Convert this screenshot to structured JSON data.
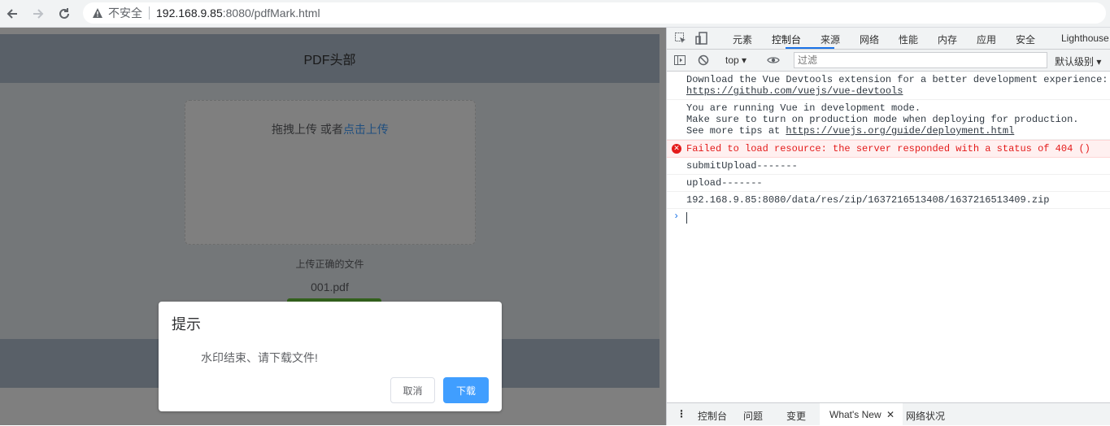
{
  "browser": {
    "security_label": "不安全",
    "url_host": "192.168.9.85",
    "url_rest": ":8080/pdfMark.html"
  },
  "page": {
    "header_title": "PDF头部",
    "upload": {
      "drag_text": "拖拽上传 或者",
      "click_text": "点击上传",
      "tip": "上传正确的文件",
      "file_name": "001.pdf"
    },
    "dialog": {
      "title": "提示",
      "message": "水印结束、请下载文件!",
      "cancel_label": "取消",
      "confirm_label": "下载"
    }
  },
  "devtools": {
    "tabs": [
      "元素",
      "控制台",
      "来源",
      "网络",
      "性能",
      "内存",
      "应用",
      "安全",
      "Lighthouse"
    ],
    "active_tab": "控制台",
    "context": "top",
    "filter_placeholder": "过滤",
    "levels": "默认级别",
    "messages": [
      {
        "line1": "Download the Vue Devtools extension for a better development experience:",
        "link": "https://github.com/vuejs/vue-devtools"
      },
      {
        "line1": "You are running Vue in development mode.",
        "line2": "Make sure to turn on production mode when deploying for production.",
        "line3_prefix": "See more tips at ",
        "link": "https://vuejs.org/guide/deployment.html"
      },
      {
        "text": "Failed to load resource: the server responded with a status of 404 ()",
        "level": "error"
      },
      {
        "text": "submitUpload-------"
      },
      {
        "text": "upload-------"
      },
      {
        "text": "192.168.9.85:8080/data/res/zip/1637216513408/1637216513409.zip"
      }
    ],
    "drawer_tabs": [
      "控制台",
      "问题",
      "变更",
      "What's New",
      "网络状况"
    ],
    "drawer_active": "What's New"
  },
  "colors": {
    "header_bg": "#b3c0d1",
    "main_bg": "#e9eef3",
    "primary": "#409eff",
    "success": "#67c23a",
    "error": "#e41a1a"
  }
}
